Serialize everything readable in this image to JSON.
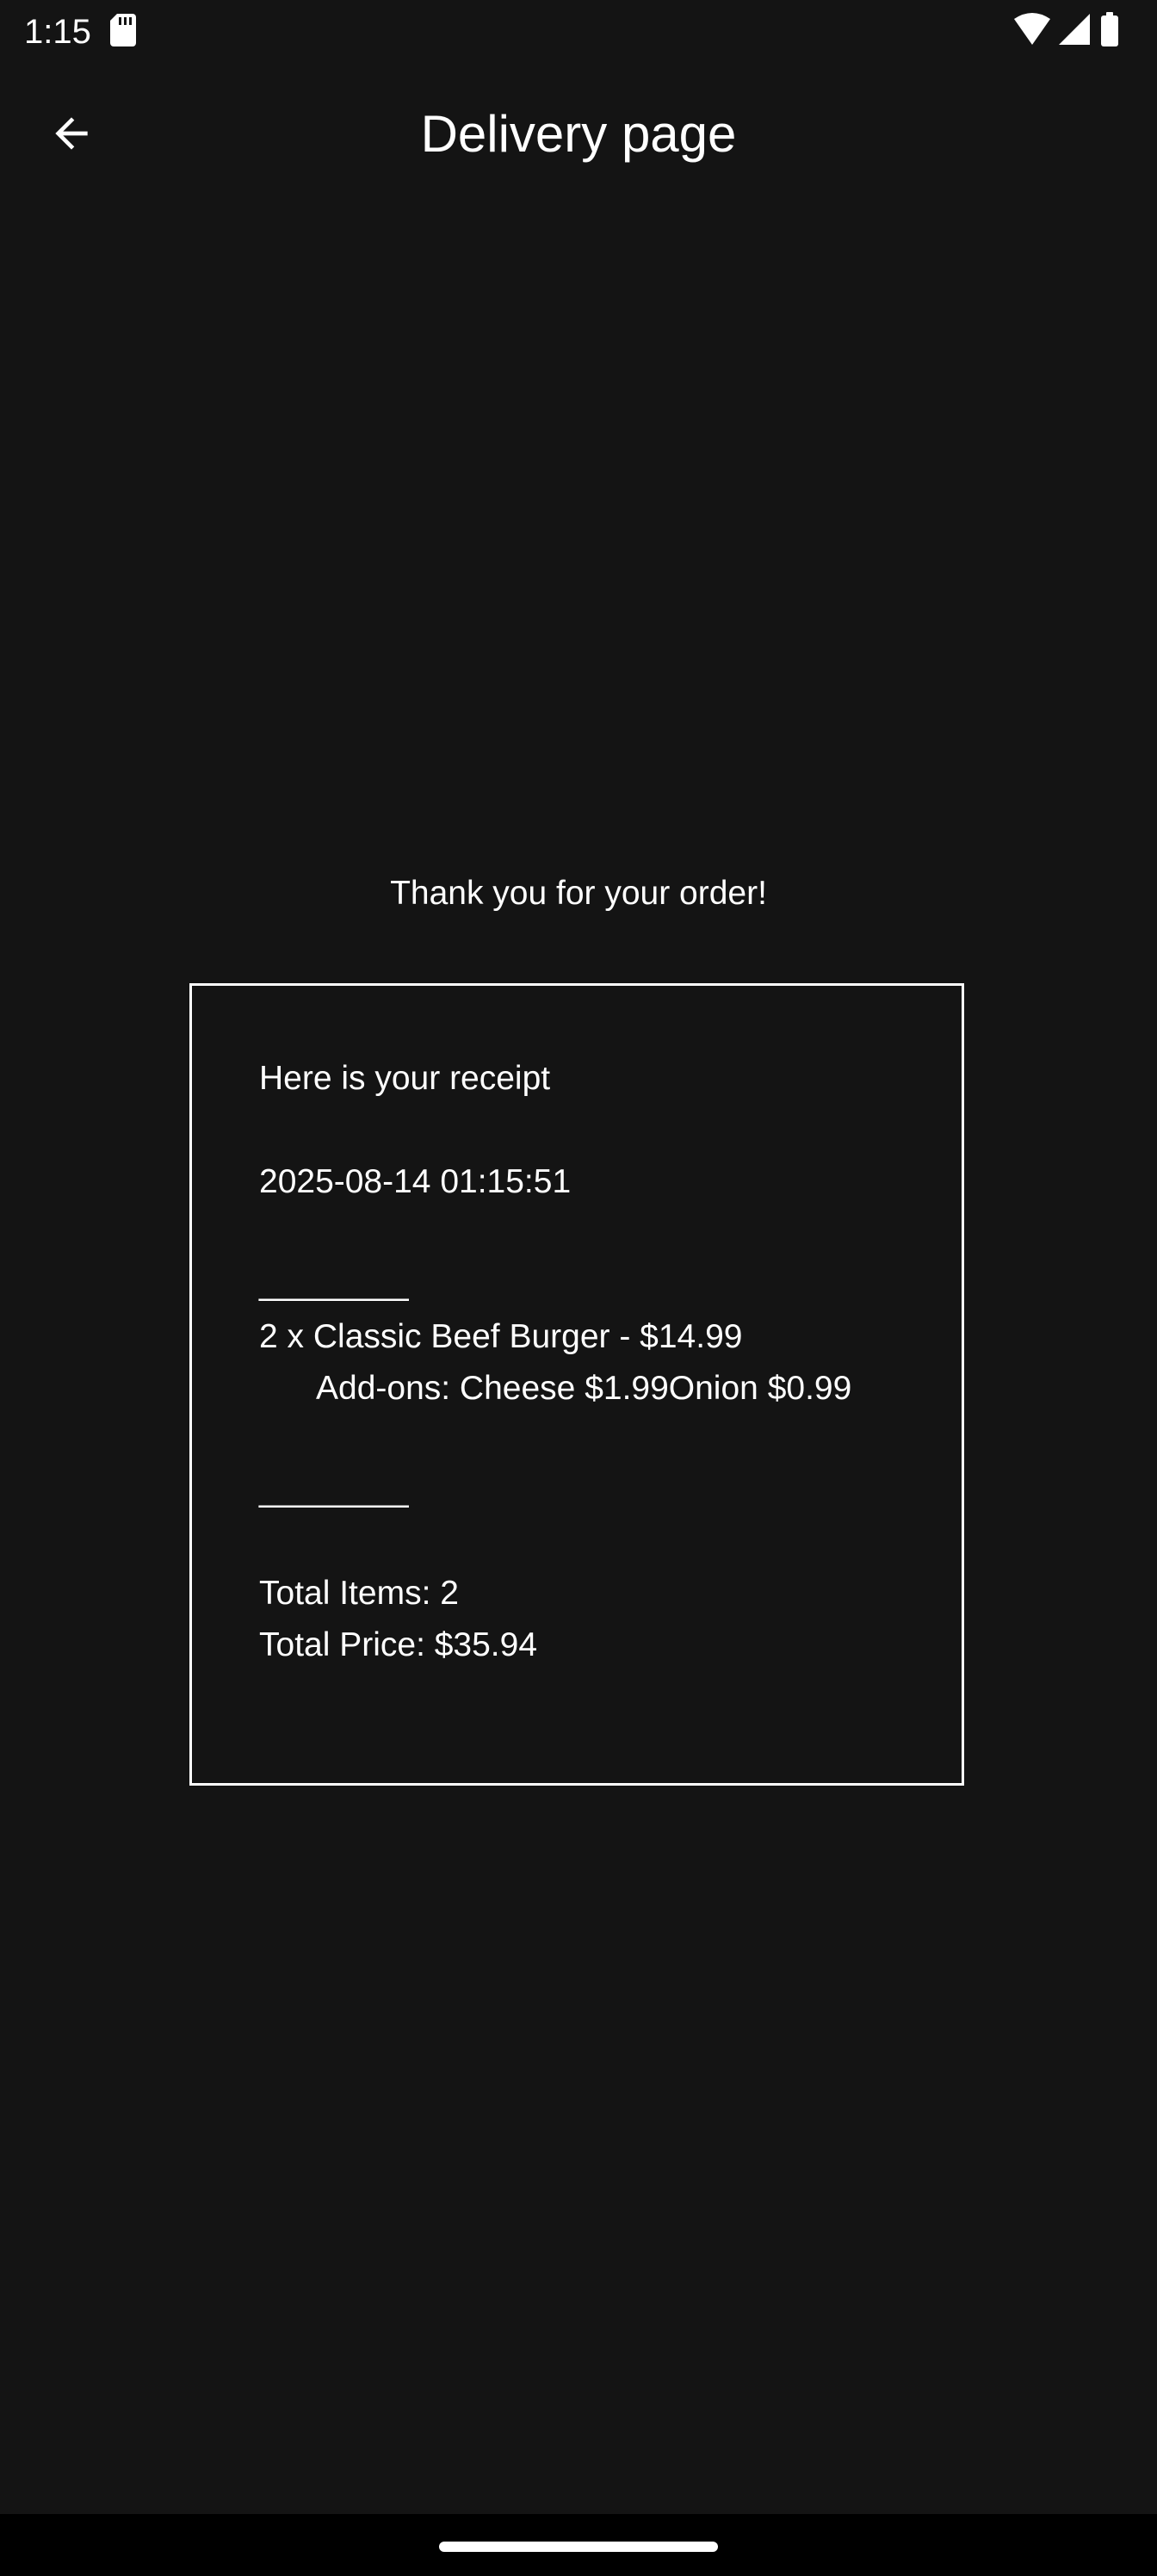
{
  "status_bar": {
    "time": "1:15",
    "icons": [
      "sd-card-icon",
      "wifi-icon",
      "signal-icon",
      "battery-icon"
    ]
  },
  "app_bar": {
    "back_icon": "arrow-back-icon",
    "title": "Delivery page"
  },
  "content": {
    "thanks": "Thank you for your order!",
    "receipt": {
      "heading": "Here is your receipt",
      "datetime": "2025-08-14 01:15:51",
      "separator_top": "________",
      "item_line": "2 x Classic Beef Burger - $14.99",
      "addons_line": "Add-ons: Cheese $1.99Onion $0.99",
      "separator_bottom": "________",
      "total_items": "Total Items: 2",
      "total_price": "Total Price: $35.94"
    }
  },
  "colors": {
    "background": "#141414",
    "text": "#ffffff",
    "nav_bar": "#000000"
  }
}
